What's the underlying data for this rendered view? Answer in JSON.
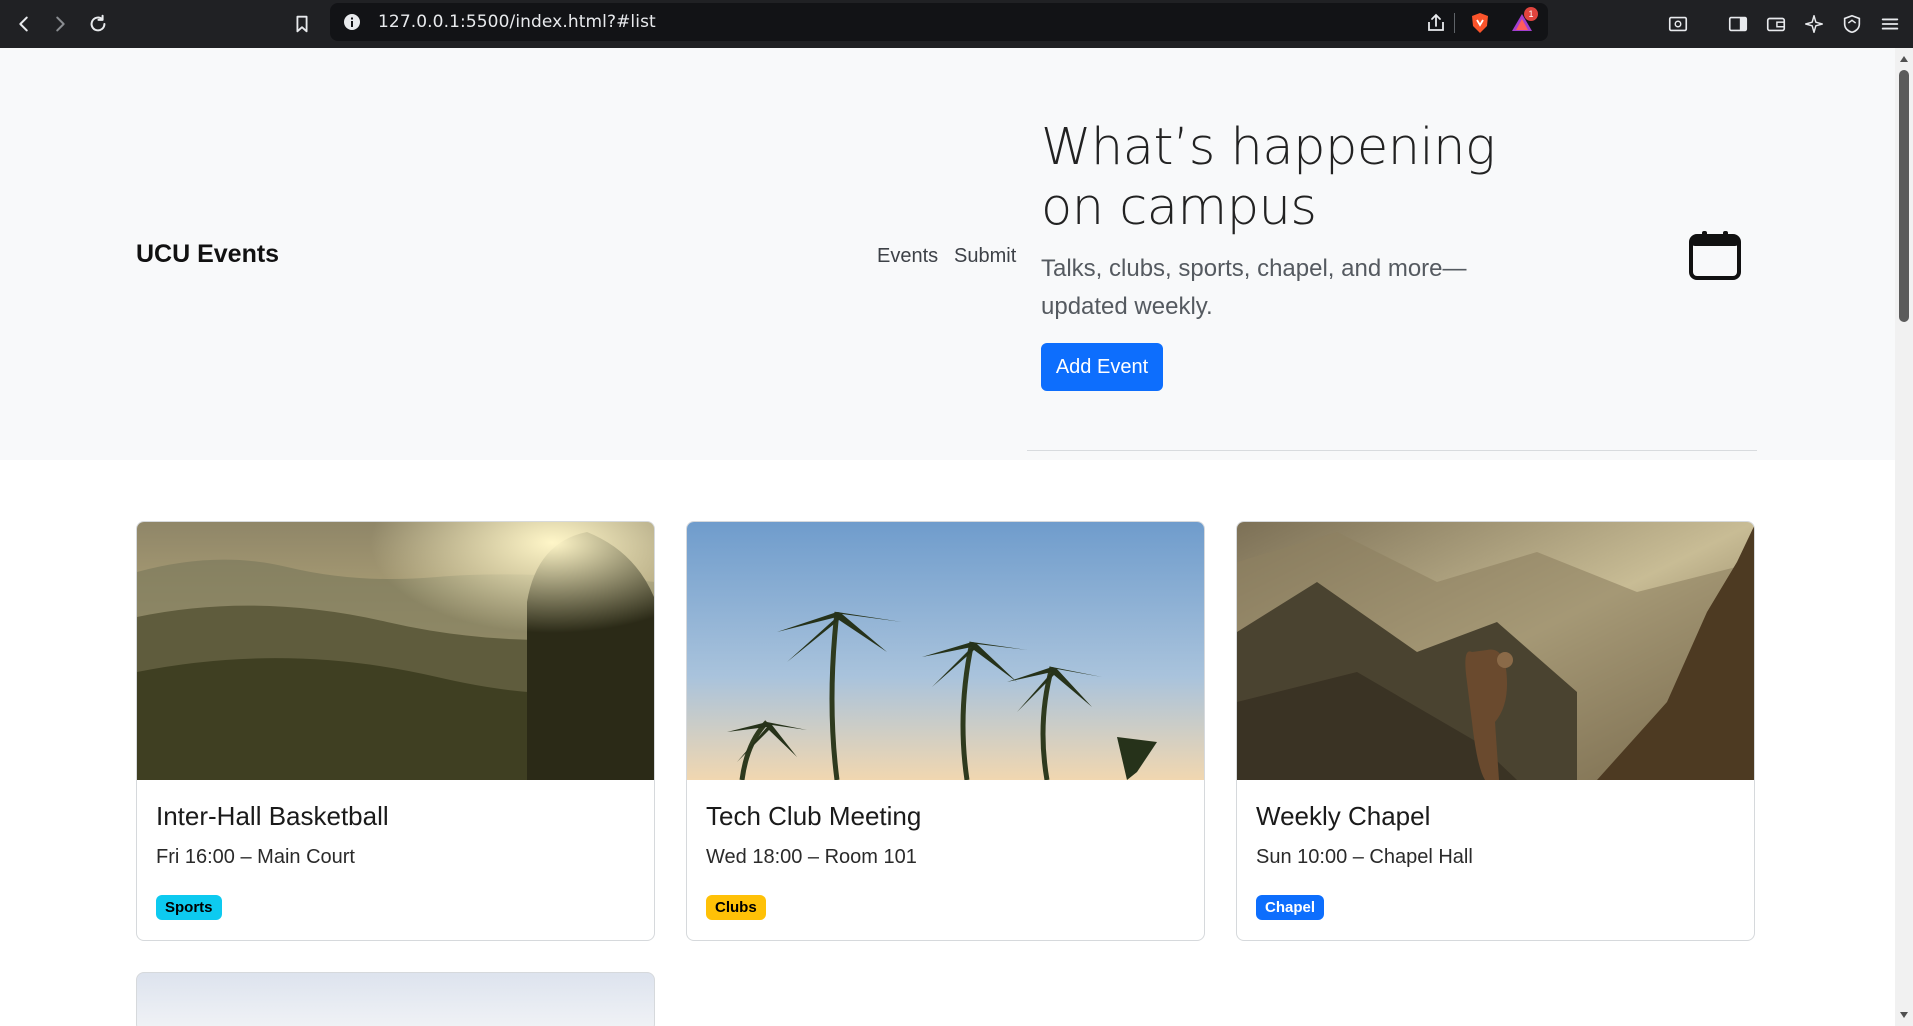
{
  "browser": {
    "url": "127.0.0.1:5500/index.html?#list",
    "notification_count": "1"
  },
  "header": {
    "brand": "UCU Events",
    "nav": [
      "Events",
      "Submit"
    ]
  },
  "hero": {
    "title": "What’s happening on campus",
    "subtitle": "Talks, clubs, sports, chapel, and more—updated weekly.",
    "cta_label": "Add Event",
    "icon": "calendar-icon"
  },
  "events": [
    {
      "title": "Inter-Hall Basketball",
      "meta": "Fri 16:00 – Main Court",
      "tag": "Sports",
      "tag_color": "#0dcaf0",
      "tag_text_color": "#000000"
    },
    {
      "title": "Tech Club Meeting",
      "meta": "Wed 18:00 – Room 101",
      "tag": "Clubs",
      "tag_color": "#ffc107",
      "tag_text_color": "#000000"
    },
    {
      "title": "Weekly Chapel",
      "meta": "Sun 10:00 – Chapel Hall",
      "tag": "Chapel",
      "tag_color": "#0d6efd",
      "tag_text_color": "#ffffff"
    }
  ],
  "colors": {
    "primary": "#0d6efd",
    "hero_bg": "#f8f9fa",
    "chrome_bg": "#202124"
  }
}
